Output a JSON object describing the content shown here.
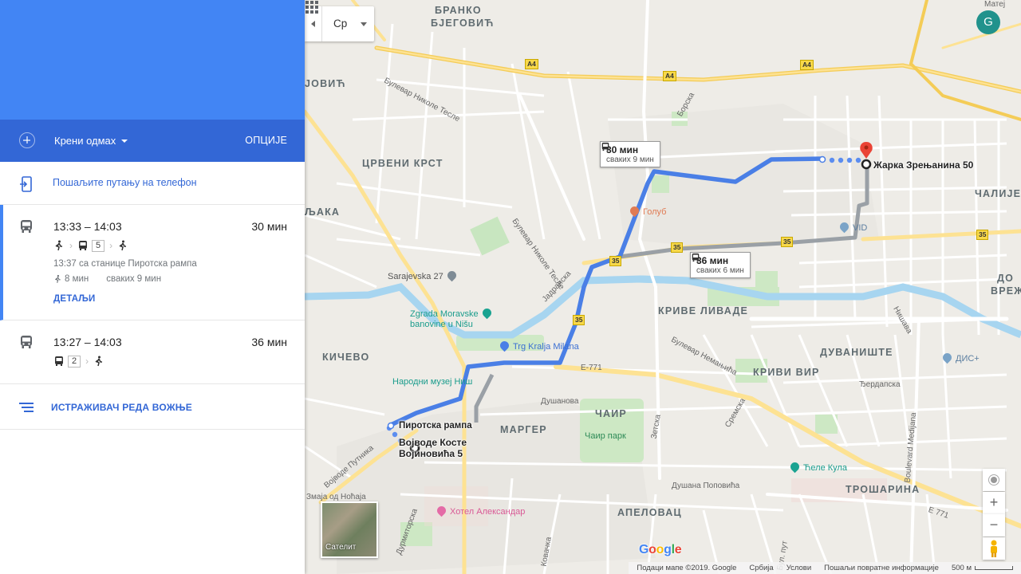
{
  "panel": {
    "depart_label": "Крени одмах",
    "options_label": "ОПЦИЈЕ",
    "send_to_phone": "Пошаљите путању на телефон",
    "explorer_label": "ИСТРАЖИВАЧ РЕДА ВОЖЊЕ",
    "routes": [
      {
        "time": "13:33 – 14:03",
        "duration": "30 мин",
        "line": "5",
        "station": "13:37 са станице Пиротска рампа",
        "walk": "8 мин",
        "frequency": "сваких 9 мин",
        "details": "ДЕТАЉИ"
      },
      {
        "time": "13:27 – 14:03",
        "duration": "36 мин",
        "line": "2"
      }
    ]
  },
  "map": {
    "language": "Ср",
    "avatar_letter": "G",
    "satellite_label": "Сателит",
    "google_logo": "Google",
    "origin": "Војводе Косте Војиновића 5",
    "origin_line1": "Војводе Косте",
    "origin_line2": "Војиновића 5",
    "stop": "Пиротска рампа",
    "destination": "Жарка Зрењанина 50",
    "callout_1": {
      "duration": "30 мин",
      "frequency": "сваких 9 мин"
    },
    "callout_2": {
      "duration": "36 мин",
      "frequency": "сваких 6 мин"
    },
    "districts": {
      "branko_1": "БРАНКО",
      "branko_2": "БЈЕГОВИЋ",
      "jovic": "ЈОВИЋ",
      "crveni_krst": "ЦРВЕНИ КРСТ",
      "ljaka": "ЉАКА",
      "calije": "ЧАЛИЈЕ",
      "krive_livade": "КРИВЕ ЛИВАДЕ",
      "kicevo": "КИЧЕВО",
      "duvaniste": "ДУВАНИШТЕ",
      "krivi_vir": "КРИВИ ВИР",
      "cair": "ЧАИР",
      "marger": "МАРГЕР",
      "trosarina": "ТРОШАРИНА",
      "apelovac": "АПЕЛОВАЦ",
      "do": "ДО",
      "vrez": "ВРЕЖ"
    },
    "pois": {
      "golub": "Голуб",
      "vid": "VID",
      "sarajevska": "Sarajevska 27",
      "zgrada_1": "Zgrada Moravske",
      "zgrada_2": "banovine u Nišu",
      "trg": "Trg Kralja Milana",
      "muzej": "Народни музеј Ниш",
      "cair_park": "Чаир парк",
      "cele_kula": "Ћеле Кула",
      "dis": "ДИС+",
      "hotel": "Хотел Александар"
    },
    "streets": {
      "bulevar_nikole_1": "Булевар Николе Тесле",
      "bulevar_nikole_2": "Булевар Николе Тесле",
      "borska": "Борска",
      "jadranska": "Јадранска",
      "bulevar_nemanjica": "Булевар Немањића",
      "dusanova": "Душанова",
      "nisava": "Нишава",
      "berdapska": "Ђердапска",
      "boulevard_medijana": "Boulevard Medijana",
      "sremska": "Сремска",
      "zetska": "Зетска",
      "vojvode_putnika": "Војводе Путника",
      "dusana_popovica": "Душана Поповића",
      "zmaja": "Змаја од Ноћаја",
      "dzrmitorska": "Дурмиторска",
      "kovanlucka": "Ковачка",
      "put": "Бул. пут",
      "mategr": "Матеј"
    },
    "highways": {
      "a4": "A4",
      "r35": "35",
      "e771": "E-771",
      "e771b": "E 771"
    },
    "footer": {
      "data": "Подаци мапе ©2019. Google",
      "country": "Србија",
      "terms": "Услови",
      "feedback": "Пошаљи повратне информације",
      "scale": "500 м"
    }
  },
  "colors": {
    "header_blue": "#4285f4",
    "bar_blue": "#3367d6",
    "route_blue": "#4a7fe6",
    "route_gray": "#9aa0a6",
    "destination_red": "#ea4335",
    "avatar": "#21928c"
  }
}
